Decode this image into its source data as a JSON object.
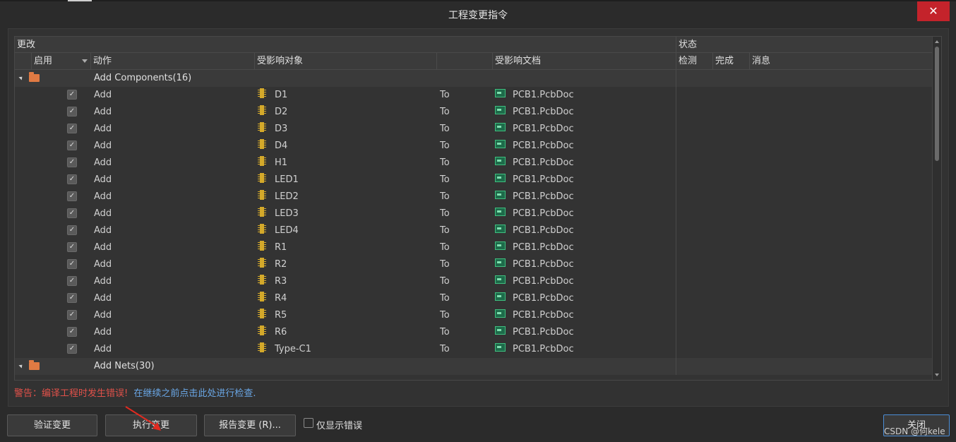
{
  "window": {
    "title": "工程变更指令",
    "close_glyph": "✕"
  },
  "headers": {
    "group_change": "更改",
    "group_status": "状态",
    "col_enable": "启用",
    "col_action": "动作",
    "col_object": "受影响对象",
    "col_document": "受影响文档",
    "col_check": "检测",
    "col_done": "完成",
    "col_message": "消息"
  },
  "groups": [
    {
      "label": "Add Components(16)"
    },
    {
      "label": "Add Nets(30)"
    }
  ],
  "rows": [
    {
      "action": "Add",
      "object": "D1",
      "to": "To",
      "document": "PCB1.PcbDoc",
      "checked": true
    },
    {
      "action": "Add",
      "object": "D2",
      "to": "To",
      "document": "PCB1.PcbDoc",
      "checked": true
    },
    {
      "action": "Add",
      "object": "D3",
      "to": "To",
      "document": "PCB1.PcbDoc",
      "checked": true
    },
    {
      "action": "Add",
      "object": "D4",
      "to": "To",
      "document": "PCB1.PcbDoc",
      "checked": true
    },
    {
      "action": "Add",
      "object": "H1",
      "to": "To",
      "document": "PCB1.PcbDoc",
      "checked": true
    },
    {
      "action": "Add",
      "object": "LED1",
      "to": "To",
      "document": "PCB1.PcbDoc",
      "checked": true
    },
    {
      "action": "Add",
      "object": "LED2",
      "to": "To",
      "document": "PCB1.PcbDoc",
      "checked": true
    },
    {
      "action": "Add",
      "object": "LED3",
      "to": "To",
      "document": "PCB1.PcbDoc",
      "checked": true
    },
    {
      "action": "Add",
      "object": "LED4",
      "to": "To",
      "document": "PCB1.PcbDoc",
      "checked": true
    },
    {
      "action": "Add",
      "object": "R1",
      "to": "To",
      "document": "PCB1.PcbDoc",
      "checked": true
    },
    {
      "action": "Add",
      "object": "R2",
      "to": "To",
      "document": "PCB1.PcbDoc",
      "checked": true
    },
    {
      "action": "Add",
      "object": "R3",
      "to": "To",
      "document": "PCB1.PcbDoc",
      "checked": true
    },
    {
      "action": "Add",
      "object": "R4",
      "to": "To",
      "document": "PCB1.PcbDoc",
      "checked": true
    },
    {
      "action": "Add",
      "object": "R5",
      "to": "To",
      "document": "PCB1.PcbDoc",
      "checked": true
    },
    {
      "action": "Add",
      "object": "R6",
      "to": "To",
      "document": "PCB1.PcbDoc",
      "checked": true
    },
    {
      "action": "Add",
      "object": "Type-C1",
      "to": "To",
      "document": "PCB1.PcbDoc",
      "checked": true
    }
  ],
  "status": {
    "warning": "警告：编译工程时发生错误!",
    "hint": "在继续之前点击此处进行检查."
  },
  "footer": {
    "validate_label": "验证变更",
    "execute_label": "执行变更",
    "report_label": "报告变更 (R)...",
    "only_errors_label": "仅显示错误",
    "close_label": "关闭",
    "watermark": "CSDN @何kele"
  },
  "colors": {
    "background": "#2b2b2b",
    "warning": "#e0514a",
    "hint": "#6aa7e6",
    "close_button": "#c4232b",
    "component_icon": "#d4a92a",
    "pcb_icon": "#3fbf7f",
    "folder_icon": "#e07a43"
  }
}
